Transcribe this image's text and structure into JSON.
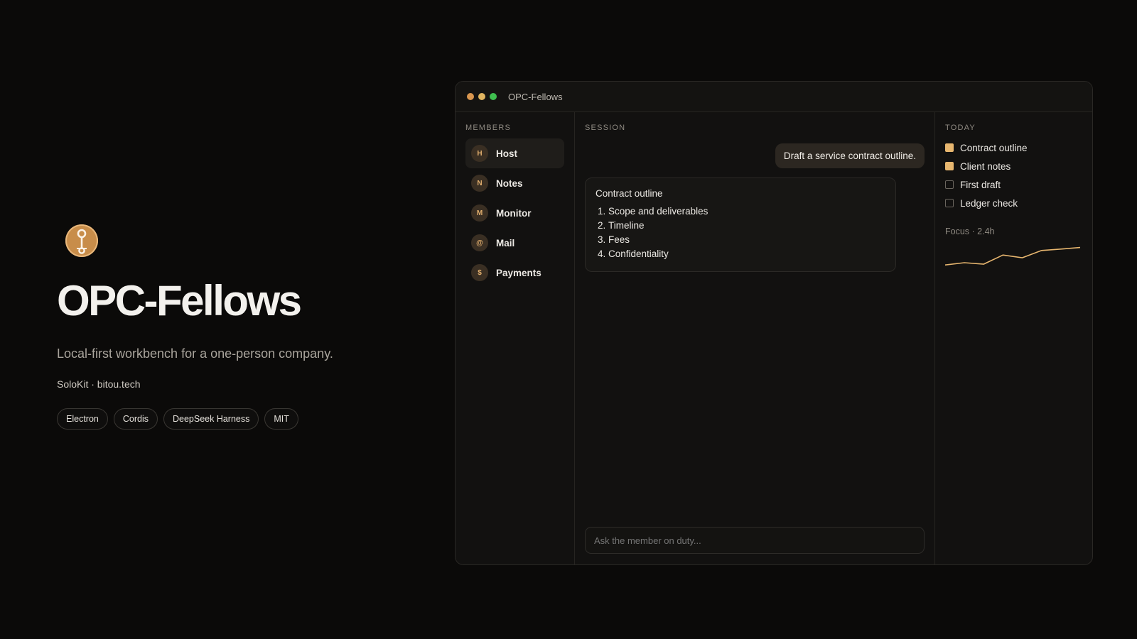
{
  "hero": {
    "title": "OPC-Fellows",
    "subtitle": "Local-first workbench for a one-person company.",
    "meta": "SoloKit · bitou.tech",
    "tags": [
      "Electron",
      "Cordis",
      "DeepSeek Harness",
      "MIT"
    ]
  },
  "window": {
    "title": "OPC-Fellows",
    "traffic_lights": [
      "#d9964f",
      "#e0b560",
      "#3fbf4f"
    ]
  },
  "members": {
    "heading": "MEMBERS",
    "items": [
      {
        "initial": "H",
        "label": "Host",
        "active": true
      },
      {
        "initial": "N",
        "label": "Notes"
      },
      {
        "initial": "M",
        "label": "Monitor"
      },
      {
        "initial": "@",
        "label": "Mail"
      },
      {
        "initial": "$",
        "label": "Payments"
      }
    ]
  },
  "session": {
    "heading": "SESSION",
    "user_message": "Draft a service contract outline.",
    "reply_title": "Contract outline",
    "reply_items": [
      "Scope and deliverables",
      "Timeline",
      "Fees",
      "Confidentiality"
    ],
    "input_placeholder": "Ask the member on duty..."
  },
  "today": {
    "heading": "TODAY",
    "tasks": [
      {
        "label": "Contract outline",
        "done": true
      },
      {
        "label": "Client notes",
        "done": true
      },
      {
        "label": "First draft",
        "done": false
      },
      {
        "label": "Ledger check",
        "done": false
      }
    ],
    "focus_label": "Focus · 2.4h",
    "focus_trend": [
      0.18,
      0.28,
      0.22,
      0.62,
      0.5,
      0.82,
      0.88,
      0.95
    ]
  },
  "colors": {
    "accent": "#e7b66f",
    "logo": "#c88d4a"
  }
}
